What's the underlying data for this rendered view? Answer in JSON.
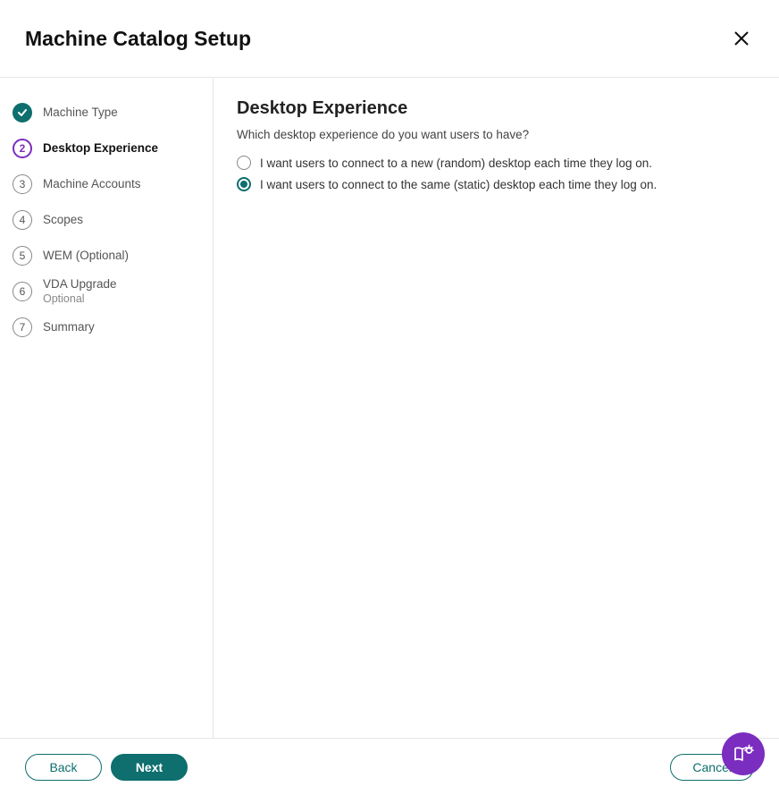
{
  "header": {
    "title": "Machine Catalog Setup"
  },
  "sidebar": {
    "steps": [
      {
        "label": "Machine Type",
        "sub": "",
        "state": "done",
        "num": ""
      },
      {
        "label": "Desktop Experience",
        "sub": "",
        "state": "active",
        "num": "2"
      },
      {
        "label": "Machine Accounts",
        "sub": "",
        "state": "pending",
        "num": "3"
      },
      {
        "label": "Scopes",
        "sub": "",
        "state": "pending",
        "num": "4"
      },
      {
        "label": "WEM (Optional)",
        "sub": "",
        "state": "pending",
        "num": "5"
      },
      {
        "label": "VDA Upgrade",
        "sub": "Optional",
        "state": "pending",
        "num": "6"
      },
      {
        "label": "Summary",
        "sub": "",
        "state": "pending",
        "num": "7"
      }
    ]
  },
  "content": {
    "heading": "Desktop Experience",
    "question": "Which desktop experience do you want users to have?",
    "options": [
      {
        "label": "I want users to connect to a new (random) desktop each time they log on.",
        "selected": false
      },
      {
        "label": "I want users to connect to the same (static) desktop each time they log on.",
        "selected": true
      }
    ]
  },
  "footer": {
    "back": "Back",
    "next": "Next",
    "cancel": "Cancel"
  }
}
